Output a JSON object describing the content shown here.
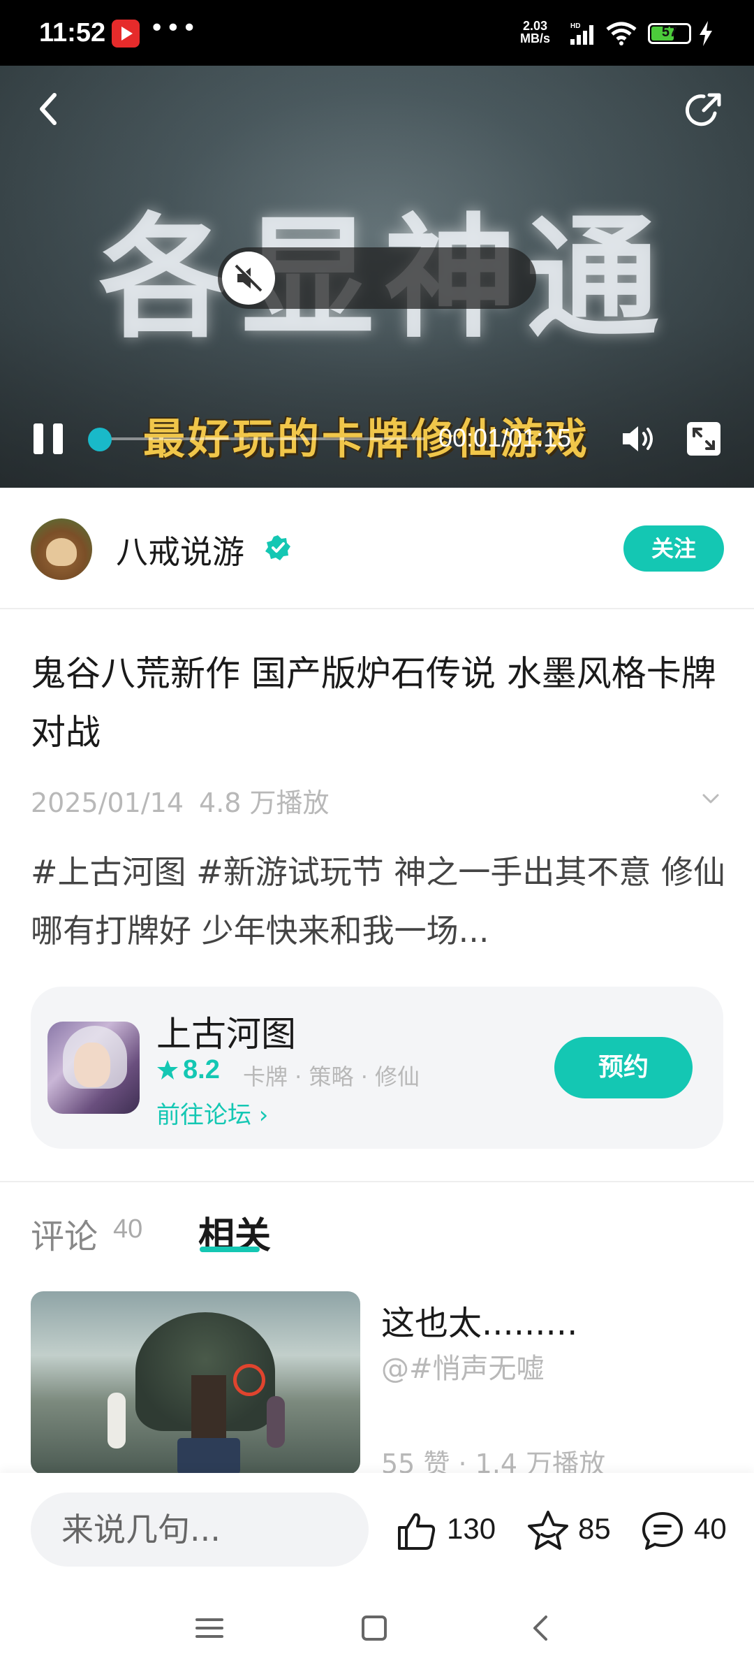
{
  "status_bar": {
    "time": "11:52",
    "more": "•••",
    "speed_value": "2.03",
    "speed_unit": "MB/s",
    "network_badge": "HD",
    "battery": "57"
  },
  "video": {
    "overlay_title": "各显神通",
    "overlay_subtitle": "最好玩的卡牌修仙游戏",
    "time": "00:01/01:15",
    "progress": 0.01
  },
  "author": {
    "name": "八戒说游",
    "follow_label": "关注"
  },
  "post": {
    "title": "鬼谷八荒新作 国产版炉石传说 水墨风格卡牌对战",
    "date": "2025/01/14",
    "views": "4.8 万播放",
    "description": "#上古河图 #新游试玩节 神之一手出其不意 修仙哪有打牌好 少年快来和我一场..."
  },
  "game_card": {
    "name": "上古河图",
    "rating": "8.2",
    "tags": "卡牌 · 策略 · 修仙",
    "forum_link": "前往论坛 ›",
    "reserve_label": "预约"
  },
  "tabs": {
    "comments_label": "评论",
    "comments_count": "40",
    "related_label": "相关"
  },
  "related": {
    "title": "这也太.........",
    "author": "@#悄声无嘘",
    "stats": "55 赞 · 1.4 万播放"
  },
  "bottom_bar": {
    "input_placeholder": "来说几句...",
    "likes": "130",
    "favorites": "85",
    "comments": "40"
  },
  "colors": {
    "accent": "#14c7b3",
    "progress": "#19b9c9",
    "text_primary": "#1a1a1a",
    "text_muted": "#b8b8b8"
  },
  "icons": [
    "back-icon",
    "share-icon",
    "mute-icon",
    "pause-icon",
    "volume-icon",
    "fullscreen-icon",
    "verified-icon",
    "star-icon",
    "expand-icon",
    "like-icon",
    "favorite-icon",
    "comment-icon",
    "nav-menu-icon",
    "nav-home-icon",
    "nav-back-icon"
  ]
}
